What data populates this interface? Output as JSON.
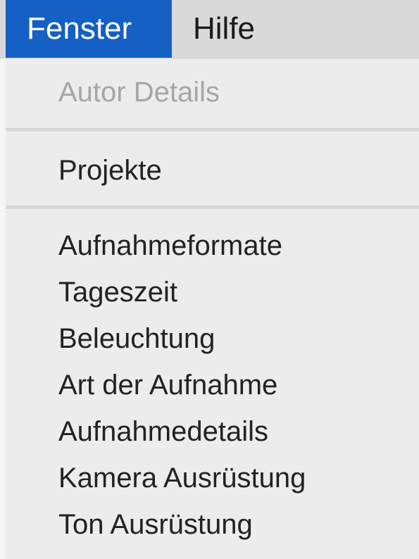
{
  "menubar": {
    "items": [
      {
        "label": "Fenster",
        "active": true
      },
      {
        "label": "Hilfe",
        "active": false
      }
    ],
    "active_color": "#1560c4"
  },
  "menu": {
    "sections": [
      {
        "items": [
          {
            "label": "Autor Details",
            "enabled": false
          }
        ]
      },
      {
        "items": [
          {
            "label": "Projekte",
            "enabled": true
          }
        ]
      },
      {
        "items": [
          {
            "label": "Aufnahmeformate",
            "enabled": true
          },
          {
            "label": "Tageszeit",
            "enabled": true
          },
          {
            "label": "Beleuchtung",
            "enabled": true
          },
          {
            "label": "Art der Aufnahme",
            "enabled": true
          },
          {
            "label": "Aufnahmedetails",
            "enabled": true
          },
          {
            "label": "Kamera Ausrüstung",
            "enabled": true
          },
          {
            "label": "Ton Ausrüstung",
            "enabled": true
          }
        ]
      }
    ]
  }
}
